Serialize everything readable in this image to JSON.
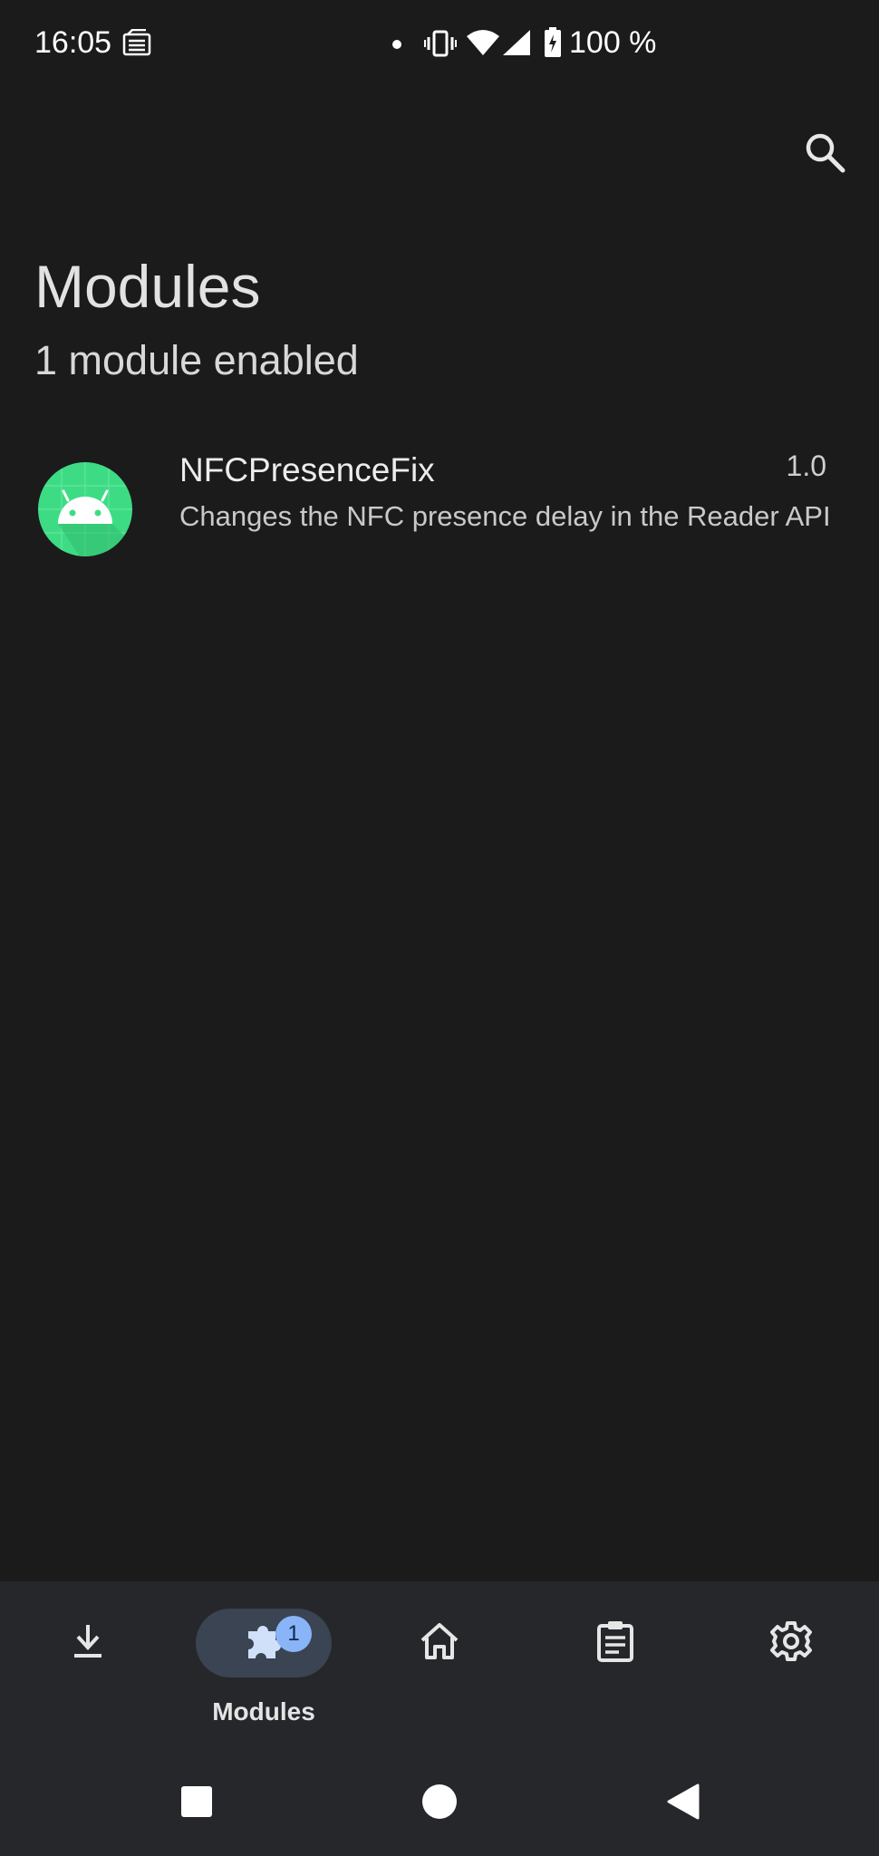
{
  "status_bar": {
    "time": "16:05",
    "battery_text": "100 %",
    "icons": [
      "sim-card-icon",
      "dot-icon",
      "vibrate-icon",
      "wifi-icon",
      "signal-icon",
      "battery-charging-icon"
    ]
  },
  "app_bar": {
    "search_icon": "search-icon"
  },
  "header": {
    "title": "Modules",
    "subtitle": "1 module enabled"
  },
  "modules": [
    {
      "name": "NFCPresenceFix",
      "version": "1.0",
      "description": "Changes the NFC presence delay in the Reader API",
      "icon": "android-icon"
    }
  ],
  "bottom_nav": {
    "items": [
      {
        "icon": "download-icon",
        "label": ""
      },
      {
        "icon": "puzzle-icon",
        "label": "Modules",
        "badge": "1",
        "active": true
      },
      {
        "icon": "home-icon",
        "label": ""
      },
      {
        "icon": "clipboard-icon",
        "label": ""
      },
      {
        "icon": "gear-icon",
        "label": ""
      }
    ]
  },
  "system_nav": {
    "buttons": [
      "recents-button",
      "home-button",
      "back-button"
    ]
  },
  "colors": {
    "background": "#1b1b1c",
    "nav_background": "#25272b",
    "active_pill": "#3a4452",
    "badge": "#8ab4f8",
    "module_icon": "#3ddc84"
  }
}
